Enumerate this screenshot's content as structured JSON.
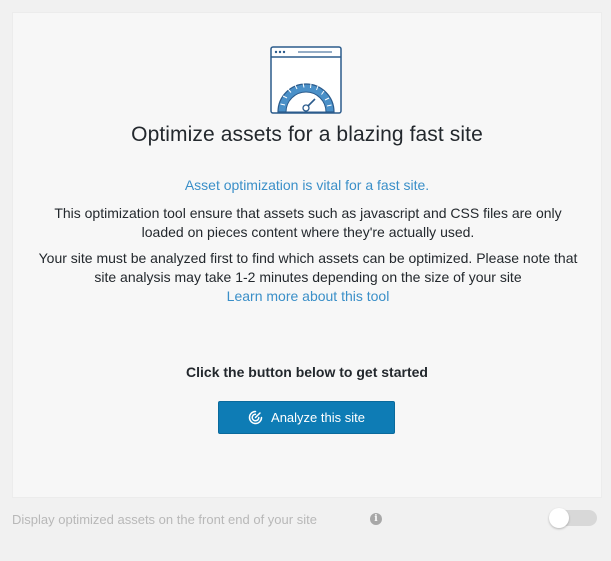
{
  "hero": {
    "icon": "browser-speedometer-icon",
    "title": "Optimize assets for a blazing fast site"
  },
  "intro": {
    "lead": "Asset optimization is vital for a fast site.",
    "paragraph1": "This optimization tool ensure that assets such as javascript and CSS files are only loaded on pieces content where they're actually used.",
    "paragraph2": "Your site must be analyzed first to find which assets can be optimized. Please note that site analysis may take 1-2 minutes depending on the size of your site",
    "learn_more_link": "Learn more about this tool"
  },
  "cta": {
    "prompt": "Click the button below to get started",
    "button_label": "Analyze this site",
    "button_icon": "analyze-radar-icon"
  },
  "footer": {
    "toggle_label": "Display optimized assets on the front end of your site",
    "info_icon": "info-icon",
    "toggle_on": false
  },
  "colors": {
    "accent": "#0e7cb5",
    "link": "#3a8fc8",
    "icon_blue": "#2b5b8c"
  }
}
